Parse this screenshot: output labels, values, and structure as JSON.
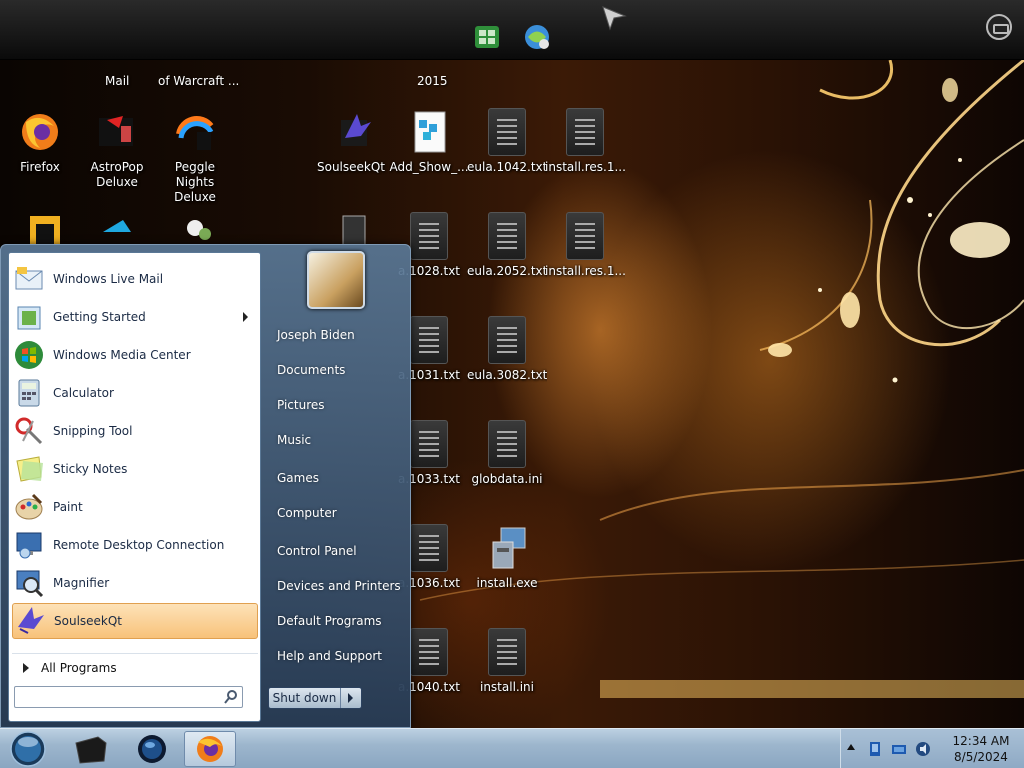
{
  "top_bar": {
    "partial_labels": [
      "Mail",
      "of Warcraft ...",
      "2015"
    ]
  },
  "desktop": {
    "icons": [
      {
        "label": "Firefox",
        "icon": "firefox-icon"
      },
      {
        "label": "AstroPop Deluxe",
        "icon": "astropop-icon"
      },
      {
        "label": "Peggle Nights Deluxe",
        "icon": "peggle-icon"
      },
      {
        "label": "SoulseekQt",
        "icon": "soulseek-icon"
      },
      {
        "label": "Add_Show_...",
        "icon": "registry-file-icon"
      },
      {
        "label": "eula.1042.txt",
        "icon": "text-file-icon"
      },
      {
        "label": "install.res.1...",
        "icon": "resource-file-icon"
      },
      {
        "label": "a.1028.txt",
        "icon": "text-file-icon"
      },
      {
        "label": "eula.2052.txt",
        "icon": "text-file-icon"
      },
      {
        "label": "install.res.1...",
        "icon": "resource-file-icon"
      },
      {
        "label": "a.1031.txt",
        "icon": "text-file-icon"
      },
      {
        "label": "eula.3082.txt",
        "icon": "text-file-icon"
      },
      {
        "label": "a.1033.txt",
        "icon": "text-file-icon"
      },
      {
        "label": "globdata.ini",
        "icon": "ini-file-icon"
      },
      {
        "label": "a.1036.txt",
        "icon": "text-file-icon"
      },
      {
        "label": "install.exe",
        "icon": "installer-icon"
      },
      {
        "label": "a.1040.txt",
        "icon": "text-file-icon"
      },
      {
        "label": "install.ini",
        "icon": "ini-file-icon"
      }
    ]
  },
  "start_menu": {
    "programs": [
      {
        "label": "Windows Live Mail",
        "icon": "mail-icon",
        "has_submenu": false
      },
      {
        "label": "Getting Started",
        "icon": "getting-started-icon",
        "has_submenu": true
      },
      {
        "label": "Windows Media Center",
        "icon": "media-center-icon",
        "has_submenu": false
      },
      {
        "label": "Calculator",
        "icon": "calculator-icon",
        "has_submenu": false
      },
      {
        "label": "Snipping Tool",
        "icon": "scissors-icon",
        "has_submenu": false
      },
      {
        "label": "Sticky Notes",
        "icon": "sticky-note-icon",
        "has_submenu": false
      },
      {
        "label": "Paint",
        "icon": "paint-palette-icon",
        "has_submenu": false
      },
      {
        "label": "Remote Desktop Connection",
        "icon": "remote-desktop-icon",
        "has_submenu": false
      },
      {
        "label": "Magnifier",
        "icon": "magnifier-icon",
        "has_submenu": false
      },
      {
        "label": "SoulseekQt",
        "icon": "soulseek-icon",
        "has_submenu": false,
        "highlighted": true
      }
    ],
    "all_programs": "All Programs",
    "search": {
      "placeholder": "",
      "value": ""
    },
    "right_items": [
      "Joseph Biden",
      "Documents",
      "Pictures",
      "Music",
      "Games",
      "Computer",
      "Control Panel",
      "Devices and Printers",
      "Default Programs",
      "Help and Support"
    ],
    "shutdown_label": "Shut down"
  },
  "taskbar": {
    "pinned": [
      "black-box-app-icon",
      "globe-app-icon",
      "firefox-icon"
    ],
    "clock": {
      "time": "12:34 AM",
      "date": "8/5/2024"
    },
    "colors": {
      "accent": "#f8c27a",
      "taskbar": "#9db6cd"
    }
  }
}
